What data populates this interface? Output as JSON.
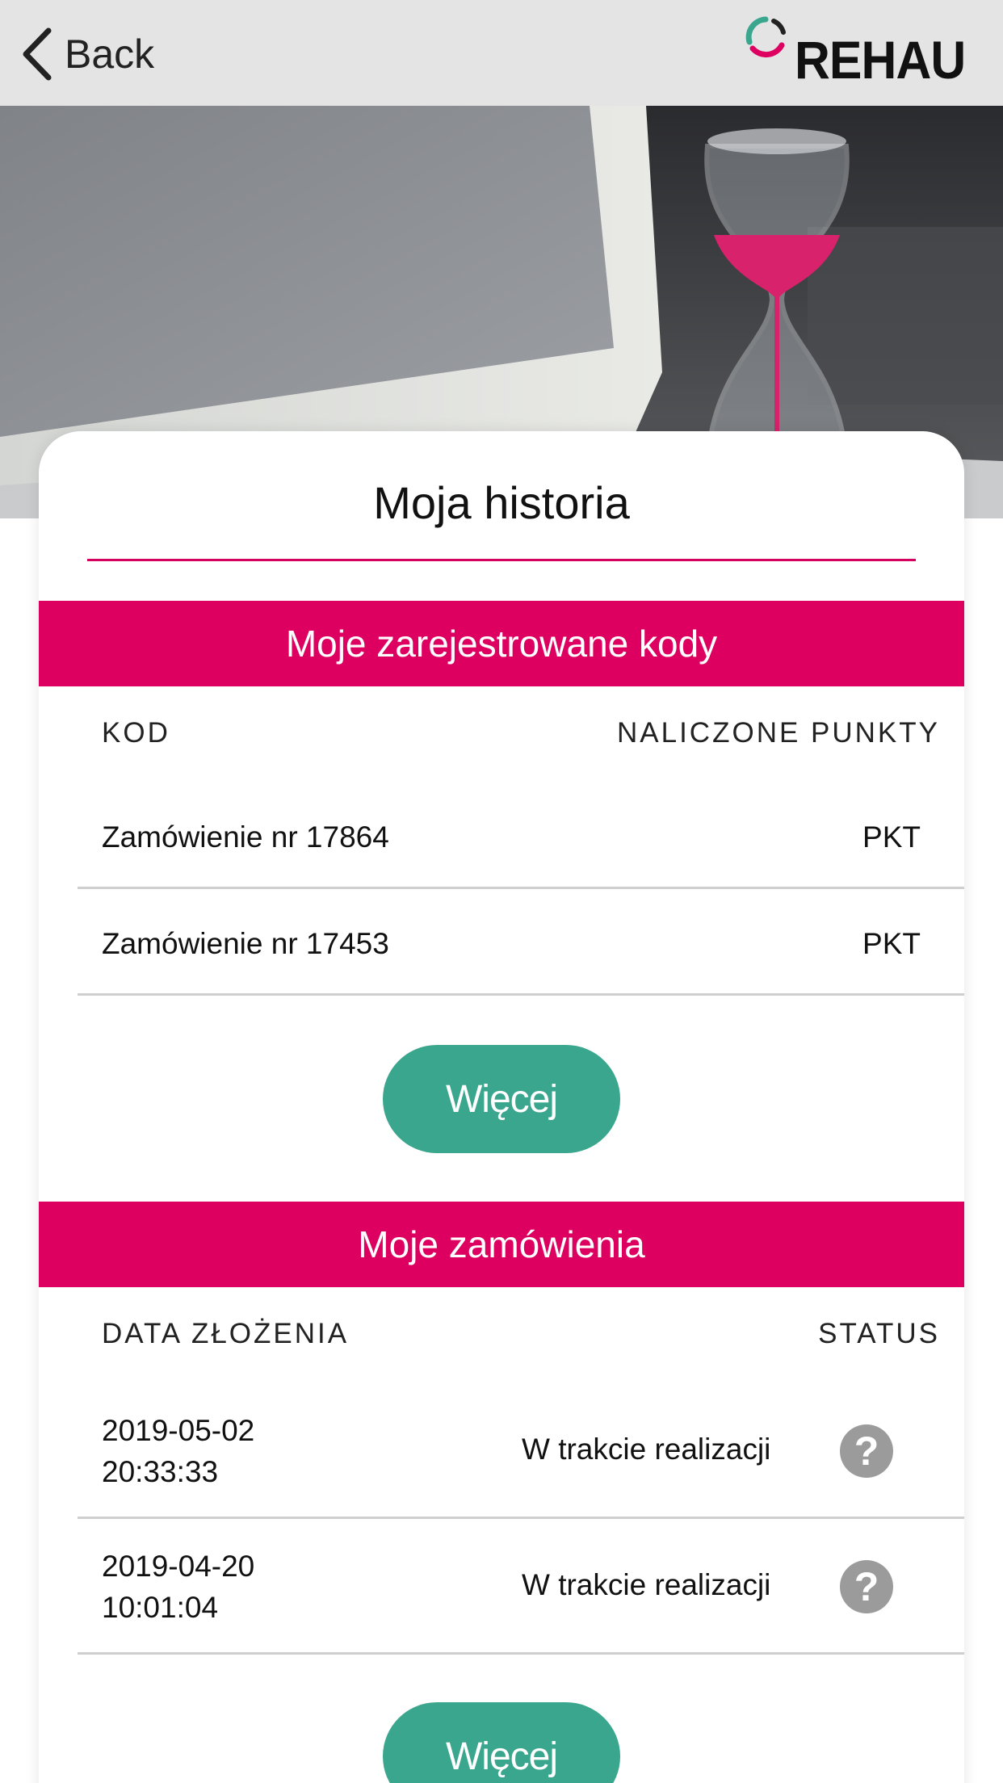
{
  "header": {
    "back_label": "Back",
    "logo_text": "REHAU",
    "logo_colors": {
      "teal": "#3aa68d",
      "pink": "#de0060",
      "dark": "#222222"
    }
  },
  "hero": {
    "image": "laptop-and-hourglass-photo"
  },
  "page": {
    "title": "Moja historia"
  },
  "codes": {
    "heading": "Moje zarejestrowane kody",
    "col_code": "KOD",
    "col_points": "NALICZONE PUNKTY",
    "rows": [
      {
        "code": "Zamówienie nr 17864",
        "points": "PKT"
      },
      {
        "code": "Zamówienie nr 17453",
        "points": "PKT"
      }
    ],
    "more_label": "Więcej"
  },
  "orders": {
    "heading": "Moje zamówienia",
    "col_date": "DATA ZŁOŻENIA",
    "col_status": "STATUS",
    "rows": [
      {
        "date": "2019-05-02",
        "time": "20:33:33",
        "status": "W trakcie realizacji",
        "help_icon": "question-icon"
      },
      {
        "date": "2019-04-20",
        "time": "10:01:04",
        "status": "W trakcie realizacji",
        "help_icon": "question-icon"
      }
    ],
    "more_label": "Więcej"
  },
  "colors": {
    "accent": "#de0060",
    "button": "#3aa68d",
    "header_bg": "#e4e4e4",
    "help_icon": "#9b9b9b"
  }
}
